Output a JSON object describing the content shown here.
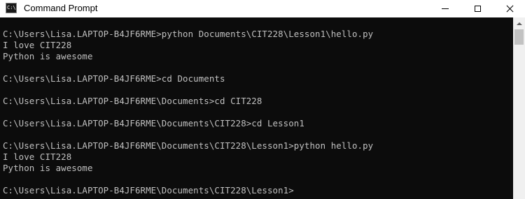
{
  "window": {
    "title": "Command Prompt",
    "app_icon": "command-prompt-icon",
    "app_icon_glyph": "C:\\."
  },
  "controls": {
    "minimize_icon": "minimize-icon",
    "maximize_icon": "maximize-icon",
    "close_icon": "close-icon"
  },
  "console": {
    "background": "#0c0c0c",
    "foreground": "#c0c0c0",
    "lines": [
      "",
      "C:\\Users\\Lisa.LAPTOP-B4JF6RME>python Documents\\CIT228\\Lesson1\\hello.py",
      "I love CIT228",
      "Python is awesome",
      "",
      "C:\\Users\\Lisa.LAPTOP-B4JF6RME>cd Documents",
      "",
      "C:\\Users\\Lisa.LAPTOP-B4JF6RME\\Documents>cd CIT228",
      "",
      "C:\\Users\\Lisa.LAPTOP-B4JF6RME\\Documents\\CIT228>cd Lesson1",
      "",
      "C:\\Users\\Lisa.LAPTOP-B4JF6RME\\Documents\\CIT228\\Lesson1>python hello.py",
      "I love CIT228",
      "Python is awesome",
      "",
      "C:\\Users\\Lisa.LAPTOP-B4JF6RME\\Documents\\CIT228\\Lesson1>"
    ]
  }
}
